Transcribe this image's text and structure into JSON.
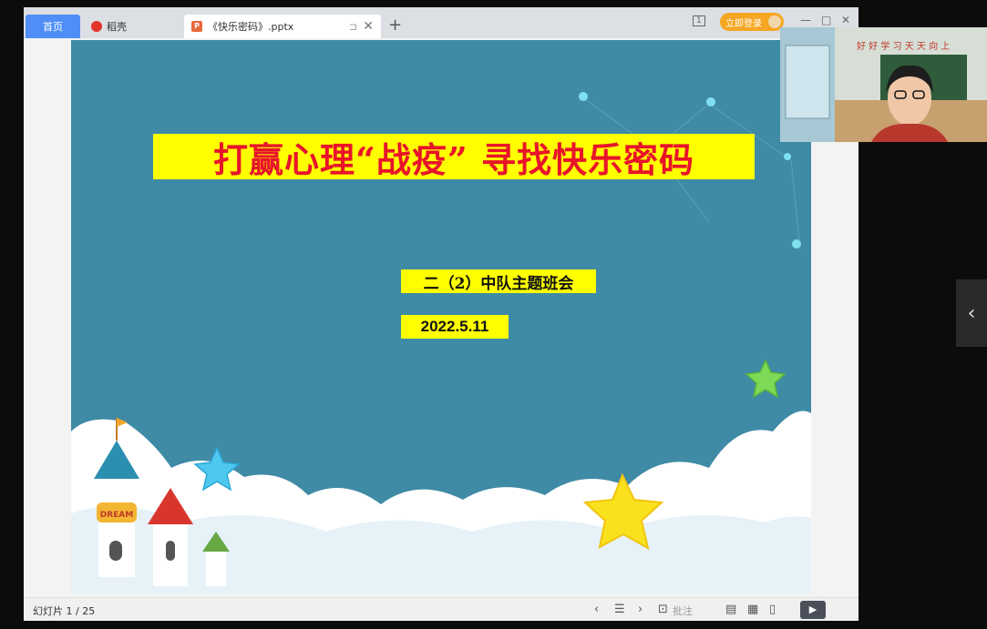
{
  "tabs": {
    "home": "首页",
    "daoke": "稻壳",
    "file": "《快乐密码》.pptx",
    "add": "+",
    "close": "✕"
  },
  "header": {
    "login": "立即登录",
    "page_indicator": "1"
  },
  "slide": {
    "title": "打赢心理“战疫”  寻找快乐密码",
    "subtitle": "二（2）中队主题班会",
    "date": "2022.5.11",
    "castle_sign": "DREAM"
  },
  "status": {
    "slide_count": "幻灯片 1 / 25",
    "comment": "批注"
  },
  "webcam": {
    "board_text": "好 好 学 习  天 天 向 上"
  },
  "colors": {
    "slide_bg": "#3f8aa5",
    "title_red": "#e8142a",
    "highlight_yellow": "#ffff00",
    "tab_blue": "#4f8ef7",
    "login_orange": "#f5a623"
  },
  "icons": [
    "daoke-icon",
    "ppt-icon",
    "pin-icon",
    "close-icon",
    "add-tab-icon",
    "reading-view-icon",
    "avatar-icon",
    "minimize-icon",
    "maximize-icon",
    "window-close-icon",
    "prev-icon",
    "list-icon",
    "next-icon",
    "comment-icon",
    "normal-view-icon",
    "grid-view-icon",
    "book-view-icon",
    "play-icon",
    "chevron-left-icon"
  ]
}
